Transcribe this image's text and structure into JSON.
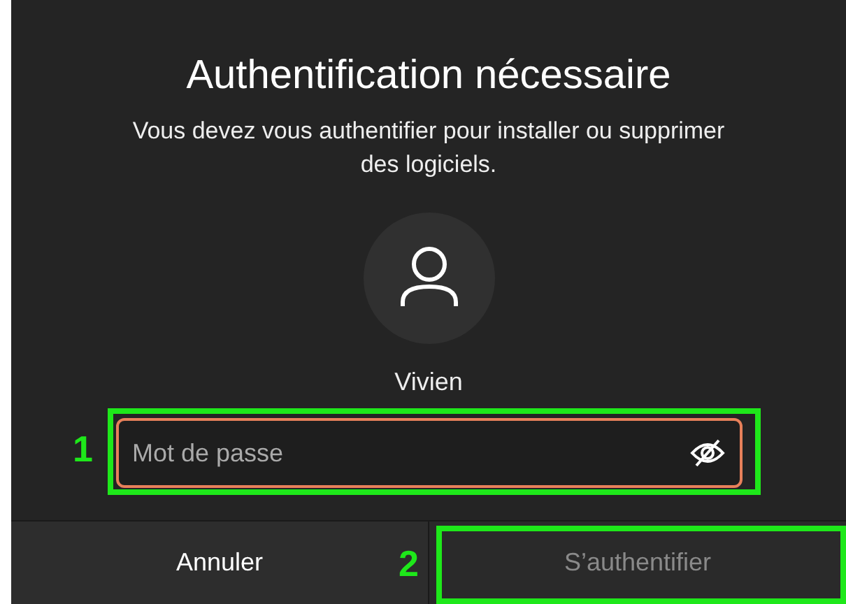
{
  "dialog": {
    "title": "Authentification nécessaire",
    "message": "Vous devez vous authentifier pour installer ou supprimer des logiciels.",
    "user": {
      "name": "Vivien"
    },
    "password_field": {
      "placeholder": "Mot de passe",
      "focused": true
    },
    "buttons": [
      {
        "label": "Annuler",
        "disabled": false
      },
      {
        "label": "S’authentifier",
        "disabled": true
      }
    ]
  },
  "annotations": [
    {
      "label": "1"
    },
    {
      "label": "2"
    }
  ]
}
